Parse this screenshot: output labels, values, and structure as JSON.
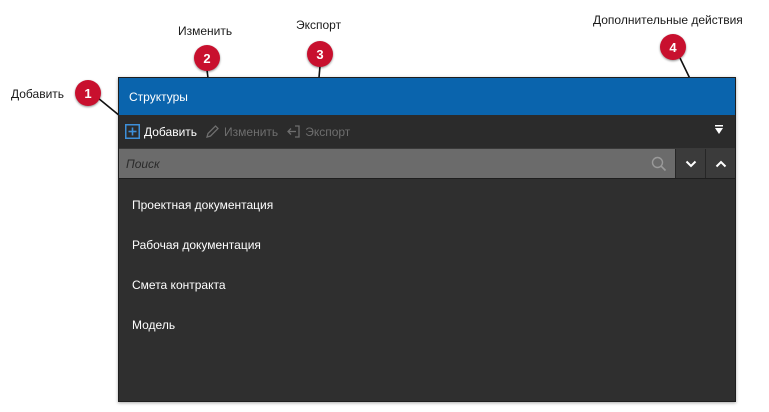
{
  "callouts": [
    {
      "number": "1",
      "label": "Добавить"
    },
    {
      "number": "2",
      "label": "Изменить"
    },
    {
      "number": "3",
      "label": "Экспорт"
    },
    {
      "number": "4",
      "label": "Дополнительные действия"
    }
  ],
  "panel": {
    "title": "Структуры",
    "toolbar": {
      "add_label": "Добавить",
      "edit_label": "Изменить",
      "export_label": "Экспорт"
    },
    "search": {
      "placeholder": "Поиск"
    },
    "items": [
      {
        "label": "Проектная документация"
      },
      {
        "label": "Рабочая документация"
      },
      {
        "label": "Смета контракта"
      },
      {
        "label": "Модель"
      }
    ]
  },
  "colors": {
    "header": "#0a64ad",
    "badge": "#c8102e",
    "panel_bg": "#2f2f2f",
    "search_bg": "#6b6b6b",
    "add_icon": "#3d8fd9"
  },
  "icons": {
    "add": "plus-square-icon",
    "edit": "pencil-icon",
    "export": "export-arrow-icon",
    "more": "triangle-down-icon",
    "search": "search-icon",
    "next": "chevron-down-icon",
    "prev": "chevron-up-icon"
  }
}
